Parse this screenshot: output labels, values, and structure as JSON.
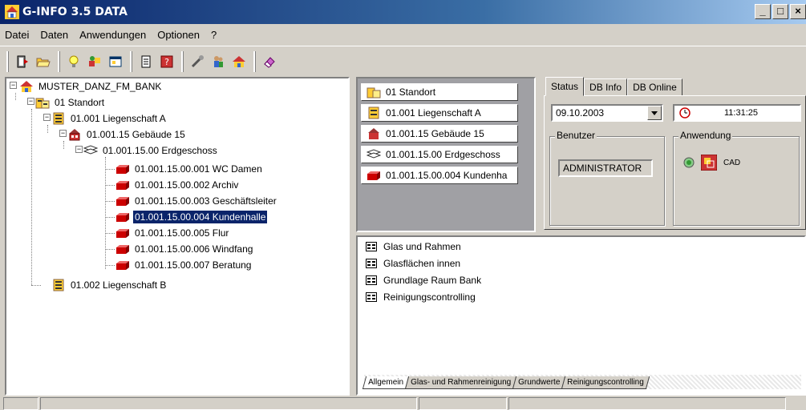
{
  "window": {
    "title": "G-INFO 3.5  DATA",
    "controls": [
      "_",
      "□",
      "×"
    ]
  },
  "menu": [
    "Datei",
    "Daten",
    "Anwendungen",
    "Optionen",
    "?"
  ],
  "toolbar": {
    "groups": [
      [
        "exit-icon",
        "open-folder-icon"
      ],
      [
        "lightbulb-icon",
        "objects-icon",
        "window-icon"
      ],
      [
        "document-icon",
        "help-icon"
      ],
      [
        "tools-icon",
        "people-icon",
        "house-icon"
      ],
      [
        "eraser-icon"
      ]
    ]
  },
  "tree": [
    {
      "label": "MUSTER_DANZ_FM_BANK",
      "icon": "house-icon"
    },
    {
      "label": "01 Standort",
      "icon": "buildings-icon"
    },
    {
      "label": "01.001 Liegenschaft A",
      "icon": "building-icon"
    },
    {
      "label": "01.001.15 Gebäude 15",
      "icon": "house-red-icon"
    },
    {
      "label": "01.001.15.00 Erdgeschoss",
      "icon": "floor-icon"
    },
    {
      "label": "01.001.15.00.001 WC Damen",
      "icon": "room-icon"
    },
    {
      "label": "01.001.15.00.002 Archiv",
      "icon": "room-icon"
    },
    {
      "label": "01.001.15.00.003 Geschäftsleiter",
      "icon": "room-icon"
    },
    {
      "label": "01.001.15.00.004 Kundenhalle",
      "icon": "room-icon",
      "selected": true
    },
    {
      "label": "01.001.15.00.005 Flur",
      "icon": "room-icon"
    },
    {
      "label": "01.001.15.00.006 Windfang",
      "icon": "room-icon"
    },
    {
      "label": "01.001.15.00.007 Beratung",
      "icon": "room-icon"
    },
    {
      "label": "01.002 Liegenschaft B",
      "icon": "building-icon"
    }
  ],
  "crumbs": [
    {
      "label": "01 Standort",
      "icon": "buildings-icon"
    },
    {
      "label": "01.001 Liegenschaft A",
      "icon": "building-icon"
    },
    {
      "label": "01.001.15 Gebäude 15",
      "icon": "house-red-icon"
    },
    {
      "label": "01.001.15.00 Erdgeschoss",
      "icon": "floor-icon"
    },
    {
      "label": "01.001.15.00.004 Kundenha",
      "icon": "room-icon"
    }
  ],
  "status": {
    "tabs": [
      "Status",
      "DB Info",
      "DB Online"
    ],
    "date": "09.10.2003",
    "time": "11:31:25",
    "user_group": "Benutzer",
    "user": "ADMINISTRATOR",
    "app_group": "Anwendung",
    "app_label": "CAD"
  },
  "list": [
    "Glas und Rahmen",
    "Glasflächen innen",
    "Grundlage Raum Bank",
    "Reinigungscontrolling"
  ],
  "bottom_tabs": [
    "Allgemein",
    "Glas- und Rahmenreinigung",
    "Grundwerte",
    "Reinigungscontrolling"
  ],
  "colors": {
    "title_start": "#0a246a",
    "title_end": "#a6caf0",
    "selection": "#0a246a",
    "face": "#d4d0c8"
  }
}
